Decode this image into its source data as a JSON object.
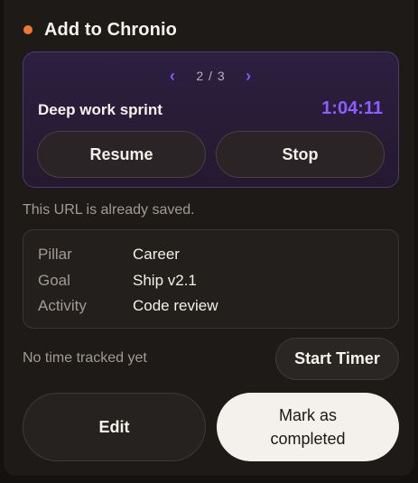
{
  "header": {
    "title": "Add to Chronio",
    "status_dot_color": "#f0782e"
  },
  "timer_card": {
    "pager": {
      "prev_icon": "chevron-left-icon",
      "next_icon": "chevron-right-icon",
      "current": 2,
      "total": 3,
      "label": "2 / 3"
    },
    "task_name": "Deep work sprint",
    "elapsed": "1:04:11",
    "elapsed_color": "#8f5cff",
    "resume_label": "Resume",
    "stop_label": "Stop"
  },
  "saved_note": "This URL is already saved.",
  "details": [
    {
      "key": "Pillar",
      "value": "Career"
    },
    {
      "key": "Goal",
      "value": "Ship v2.1"
    },
    {
      "key": "Activity",
      "value": "Code review"
    }
  ],
  "tracking": {
    "status": "No time tracked yet",
    "start_label": "Start Timer"
  },
  "actions": {
    "edit_label": "Edit",
    "complete_label": "Mark as completed"
  }
}
